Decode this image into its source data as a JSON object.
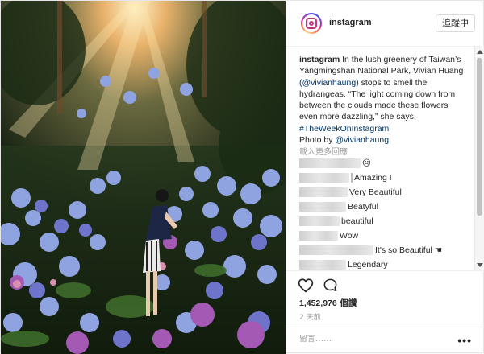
{
  "header": {
    "username": "instagram",
    "follow_label": "追蹤中"
  },
  "caption": {
    "author": "instagram",
    "lines": [
      " In the lush greenery of Taiwan’s",
      "Yangmingshan National Park, Vivian Huang",
      "stops to smell the",
      "hydrangeas. “The light coming down from",
      "between the clouds made these flowers",
      "even more dazzling,” she says.",
      "#TheWeekOnInstagram",
      "Photo by "
    ],
    "mention_1": "(@vivianhaung)",
    "mention_2": "@vivianhaung"
  },
  "load_more": "載入更多回應",
  "comments": [
    {
      "text": "☹"
    },
    {
      "text": "Amazing !"
    },
    {
      "text": "Very Beautiful"
    },
    {
      "text": "Beatyful"
    },
    {
      "text": "beautiful"
    },
    {
      "text": "Wow"
    },
    {
      "text": "It's so Beautiful ☚"
    },
    {
      "text": "Legendary"
    }
  ],
  "actions": {
    "like_icon": "heart-icon",
    "comment_icon": "comment-bubble-icon",
    "likes_count": "1,452,976",
    "likes_unit": " 個讚",
    "time_ago": "2 天前"
  },
  "comment_box": {
    "placeholder": "留言……",
    "more_label": "•••"
  }
}
